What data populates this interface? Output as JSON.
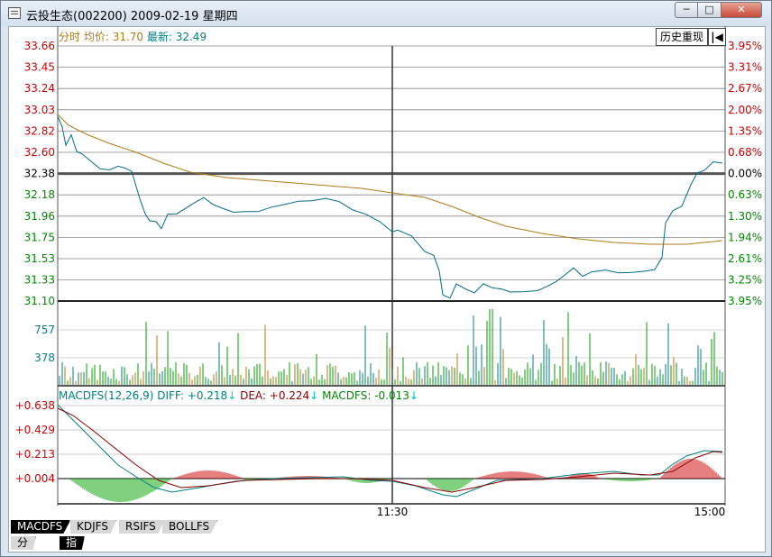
{
  "window": {
    "title": "云投生态(002200) 2009-02-19 星期四",
    "min_label": "─",
    "max_label": "□",
    "close_label": "✕"
  },
  "header": {
    "fenshi_label": "分时",
    "avg_label": "均价:",
    "avg_value": "31.70",
    "last_label": "最新:",
    "last_value": "32.49",
    "history_button": "历史重现",
    "back_icon": "arrow-left-bar-icon"
  },
  "price_axis": {
    "left_labels": [
      "33.66",
      "33.45",
      "33.24",
      "33.03",
      "32.82",
      "32.60",
      "32.38",
      "32.18",
      "31.96",
      "31.75",
      "31.53",
      "31.33",
      "31.10"
    ],
    "right_labels": [
      "3.95%",
      "3.31%",
      "2.67%",
      "2.00%",
      "1.35%",
      "0.68%",
      "0.00%",
      "0.63%",
      "1.30%",
      "1.94%",
      "2.61%",
      "3.25%",
      "3.95%"
    ],
    "up_color": "#cc0000",
    "down_color": "#008800",
    "flat_color": "#000000"
  },
  "volume_axis": {
    "labels": [
      "757",
      "378"
    ],
    "color": "#008080"
  },
  "macd": {
    "title": "MACDFS(12,26,9)",
    "diff_label": "DIFF:",
    "diff_value": "+0.218",
    "dea_label": "DEA:",
    "dea_value": "+0.224",
    "macd_label": "MACDFS:",
    "macd_value": "-0.013",
    "arrow": "↓",
    "labels": [
      "+0.638",
      "+0.429",
      "+0.213",
      "+0.004"
    ]
  },
  "time_axis": {
    "labels": [
      "11:30",
      "15:00"
    ]
  },
  "indicator_tabs": [
    "MACDFS",
    "KDJFS",
    "RSIFS",
    "BOLLFS"
  ],
  "bottom_tabs": [
    "分时量",
    "指标"
  ],
  "colors": {
    "price_line": "#006b8a",
    "avg_line": "#b07a18",
    "dea_line": "#8b0000",
    "diff_line": "#008080",
    "grid": "#000000"
  }
}
